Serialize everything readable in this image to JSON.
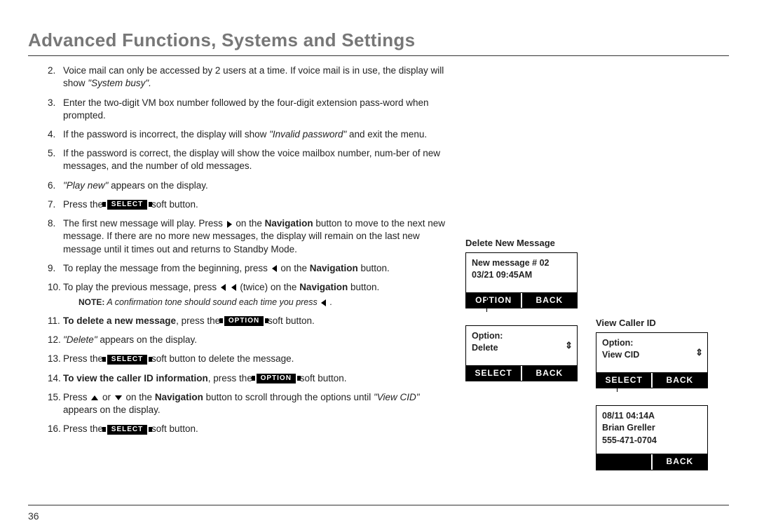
{
  "page": {
    "title": "Advanced Functions, Systems and Settings",
    "number": "36"
  },
  "steps": {
    "s2_a": "Voice mail can only be accessed by 2 users at a time. If voice mail is in use, the display will show ",
    "s2_b": "\"System busy\".",
    "s3": "Enter the two-digit VM box number followed by the four-digit extension pass-word when prompted.",
    "s4_a": "If the password is incorrect, the display will show ",
    "s4_b": "\"Invalid password\"",
    "s4_c": " and exit the menu.",
    "s5": "If the password is correct, the display will show the voice mailbox number, num-ber of new messages, and the number of old messages.",
    "s6_a": "\"Play new\"",
    "s6_b": " appears on the display.",
    "s7_a": "Press the ",
    "s7_b": " soft button.",
    "s8_a": "The first new message will play. Press ",
    "s8_b": " on the ",
    "s8_c": "Navigation",
    "s8_d": " button to move to the next new message. If there are no more new messages, the display will remain on the last new message until it times out and returns to Standby Mode.",
    "s9_a": "To replay the message from the beginning, press ",
    "s9_b": " on the ",
    "s9_c": "Navigation",
    "s9_d": " button.",
    "s10_a": "To play the previous message, press ",
    "s10_b": " (twice) on the ",
    "s10_c": "Navigation",
    "s10_d": " button.",
    "note_label": "NOTE:",
    "note_text": " A confirmation tone should sound each time you press ",
    "s11_a": "To delete a new message",
    "s11_b": ", press the ",
    "s11_c": " soft button.",
    "s12_a": "\"Delete\"",
    "s12_b": " appears on the display.",
    "s13_a": "Press the ",
    "s13_b": " soft button to delete the message.",
    "s14_a": "To view the caller ID information",
    "s14_b": ", press the ",
    "s14_c": " soft button.",
    "s15_a": "Press ",
    "s15_b": " or ",
    "s15_c": " on the ",
    "s15_d": "Navigation",
    "s15_e": " button to scroll through the options until ",
    "s15_f": "\"View CID\"",
    "s15_g": " appears on the display.",
    "s16_a": "Press the ",
    "s16_b": " soft button."
  },
  "chips": {
    "select": "SELECT",
    "option": "OPTION"
  },
  "diagrams": {
    "d1_title": "Delete New Message",
    "d1_line1": "New message # 02",
    "d1_line2": "03/21 09:45AM",
    "d1_sk_left": "OPTION",
    "d1_sk_right": "BACK",
    "d2_body1": "Option:",
    "d2_body2": "Delete",
    "d2_sk_left": "SELECT",
    "d2_sk_right": "BACK",
    "d3_title": "View Caller ID",
    "d3_body1": "Option:",
    "d3_body2": "View CID",
    "d3_sk_left": "SELECT",
    "d3_sk_right": "BACK",
    "d4_line1": "08/11 04:14A",
    "d4_line2": "Brian Greller",
    "d4_line3": "555-471-0704",
    "d4_sk_right": "BACK",
    "scroll": "⇕"
  }
}
